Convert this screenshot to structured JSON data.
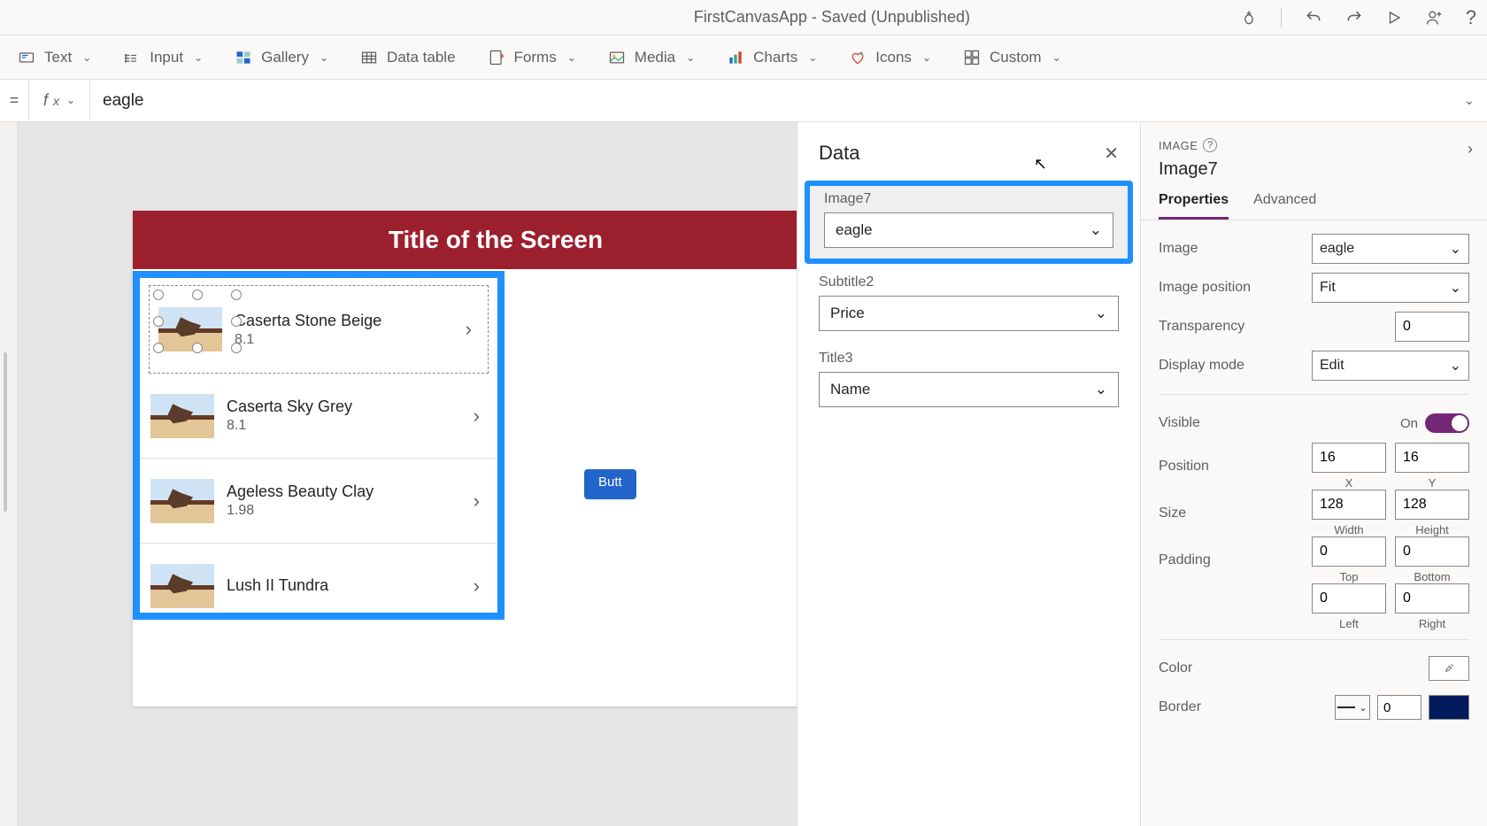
{
  "titlebar": {
    "app_state": "FirstCanvasApp - Saved (Unpublished)"
  },
  "ribbon": {
    "text": "Text",
    "input": "Input",
    "gallery": "Gallery",
    "datatable": "Data table",
    "forms": "Forms",
    "media": "Media",
    "charts": "Charts",
    "icons": "Icons",
    "custom": "Custom"
  },
  "formula": {
    "value": "eagle"
  },
  "screen": {
    "title": "Title of the Screen",
    "button_label": "Butt"
  },
  "gallery": {
    "items": [
      {
        "title": "Caserta Stone Beige",
        "sub": "8.1"
      },
      {
        "title": "Caserta Sky Grey",
        "sub": "8.1"
      },
      {
        "title": "Ageless Beauty Clay",
        "sub": "1.98"
      },
      {
        "title": "Lush II Tundra",
        "sub": ""
      }
    ]
  },
  "dataPanel": {
    "title": "Data",
    "fields": {
      "image": {
        "label": "Image7",
        "value": "eagle"
      },
      "sub": {
        "label": "Subtitle2",
        "value": "Price"
      },
      "title": {
        "label": "Title3",
        "value": "Name"
      }
    }
  },
  "props": {
    "type": "IMAGE",
    "name": "Image7",
    "tabs": {
      "properties": "Properties",
      "advanced": "Advanced"
    },
    "image": {
      "label": "Image",
      "value": "eagle"
    },
    "imagePos": {
      "label": "Image position",
      "value": "Fit"
    },
    "transparency": {
      "label": "Transparency",
      "value": "0"
    },
    "displayMode": {
      "label": "Display mode",
      "value": "Edit"
    },
    "visible": {
      "label": "Visible",
      "state": "On"
    },
    "position": {
      "label": "Position",
      "x": "16",
      "xlab": "X",
      "y": "16",
      "ylab": "Y"
    },
    "size": {
      "label": "Size",
      "w": "128",
      "wlab": "Width",
      "h": "128",
      "hlab": "Height"
    },
    "padding": {
      "label": "Padding",
      "t": "0",
      "tlab": "Top",
      "b": "0",
      "blab": "Bottom",
      "l": "0",
      "llab": "Left",
      "r": "0",
      "rlab": "Right"
    },
    "color": {
      "label": "Color"
    },
    "border": {
      "label": "Border",
      "width": "0"
    }
  }
}
